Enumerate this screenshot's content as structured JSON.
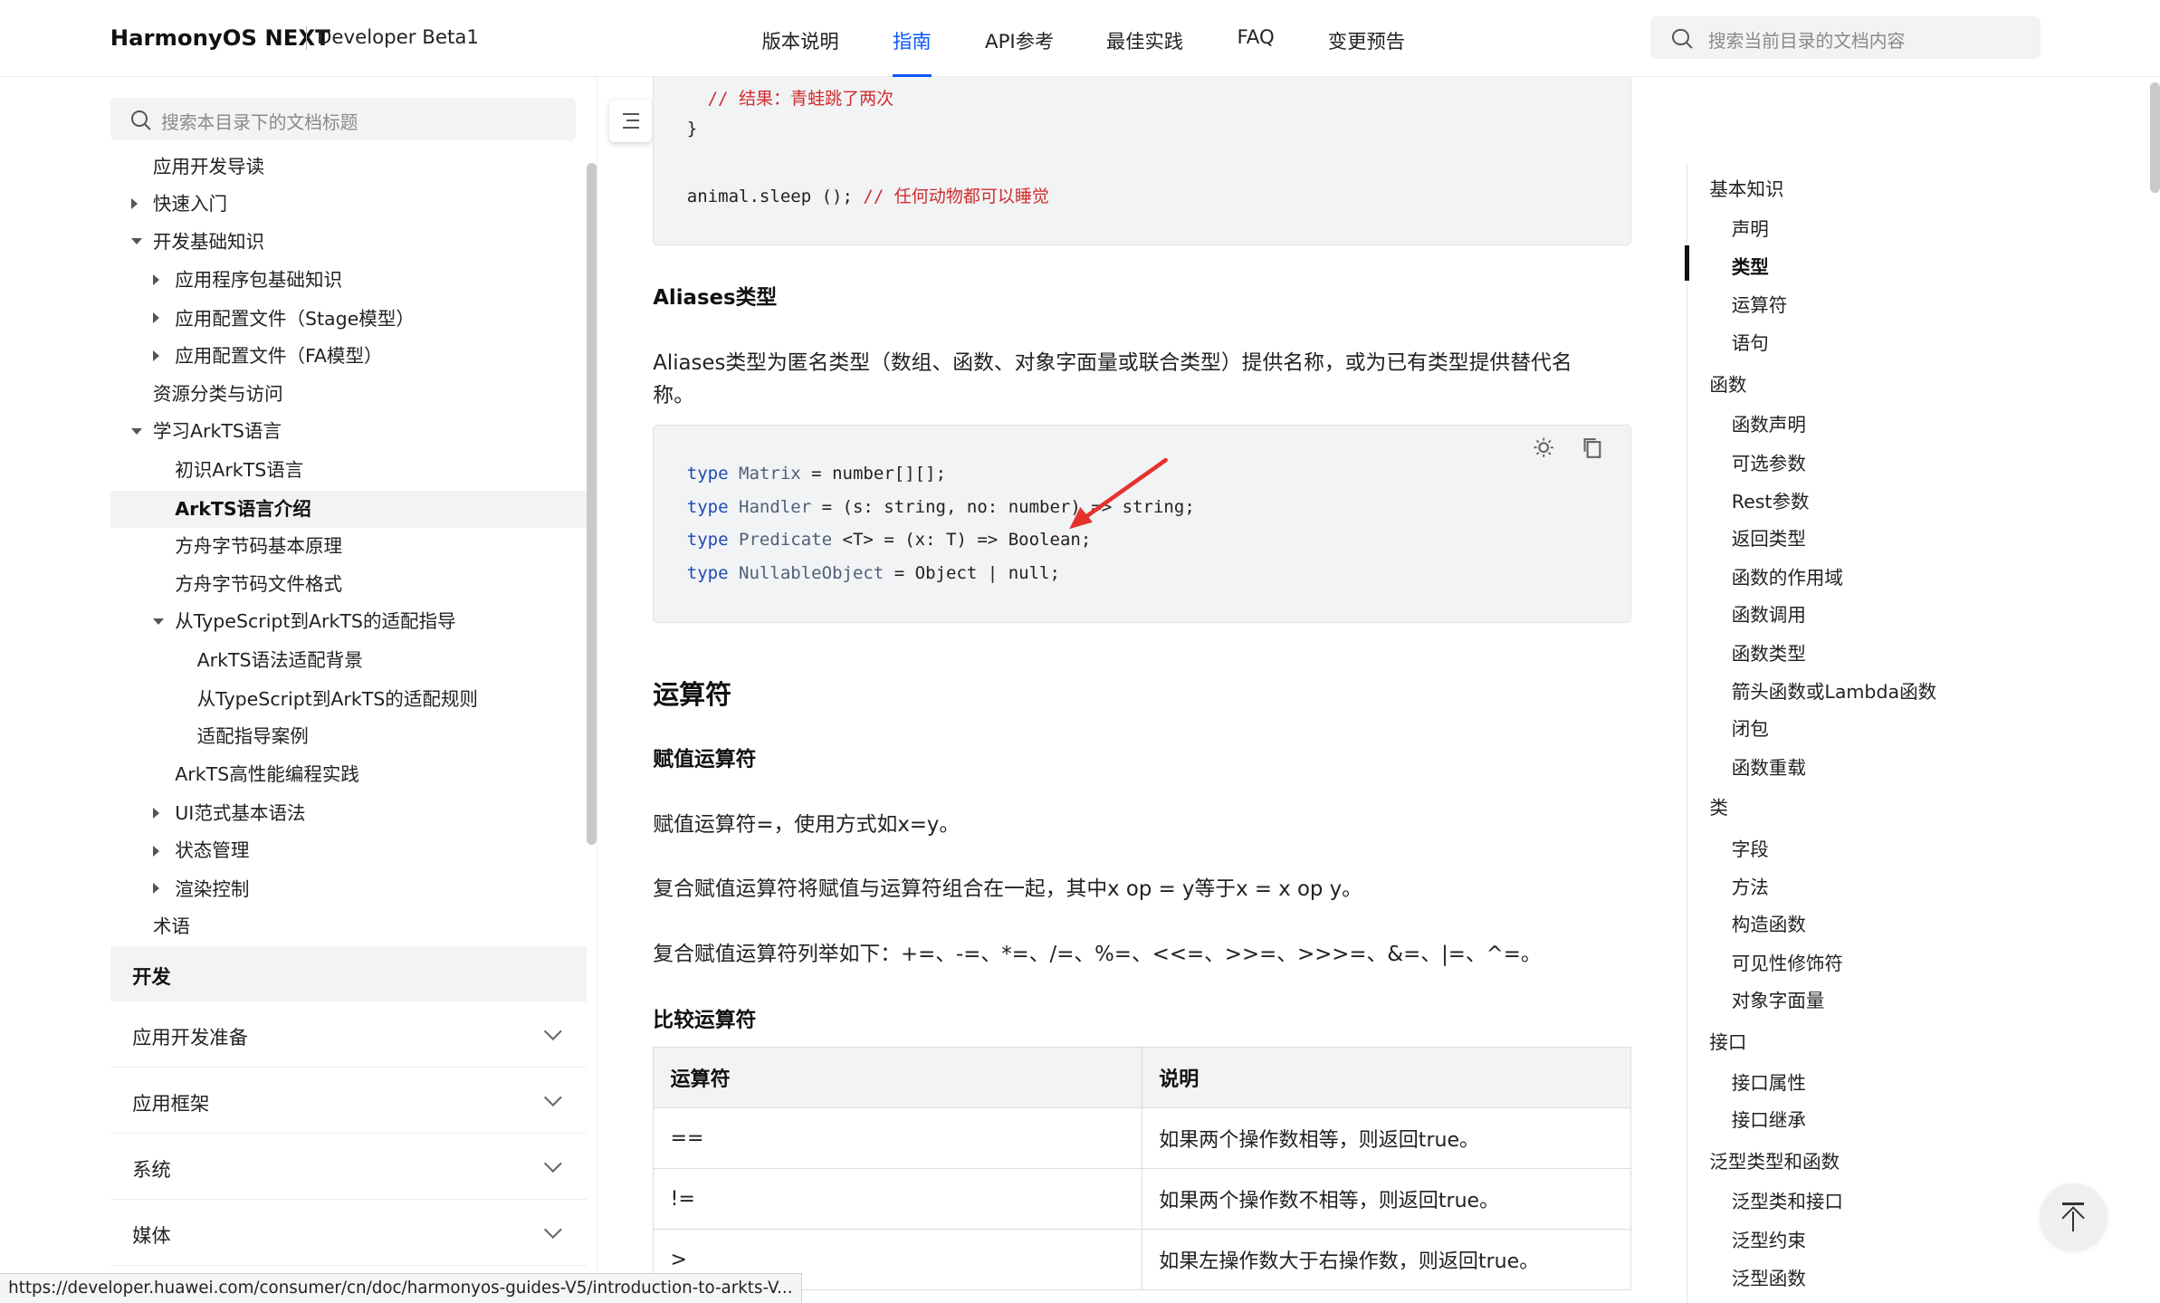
{
  "header": {
    "brand": "HarmonyOS NEXT",
    "brand_sub": "Developer Beta1",
    "nav": [
      "版本说明",
      "指南",
      "API参考",
      "最佳实践",
      "FAQ",
      "变更预告"
    ],
    "active_nav": "指南",
    "search_placeholder": "搜索当前目录的文档内容"
  },
  "sidebar": {
    "search_placeholder": "搜索本目录下的文档标题",
    "tree": [
      {
        "label": "应用开发导读",
        "level": 0,
        "state": "leaf"
      },
      {
        "label": "快速入门",
        "level": 0,
        "state": "collapsed"
      },
      {
        "label": "开发基础知识",
        "level": 0,
        "state": "expanded"
      },
      {
        "label": "应用程序包基础知识",
        "level": 1,
        "state": "collapsed"
      },
      {
        "label": "应用配置文件（Stage模型）",
        "level": 1,
        "state": "collapsed"
      },
      {
        "label": "应用配置文件（FA模型）",
        "level": 1,
        "state": "collapsed"
      },
      {
        "label": "资源分类与访问",
        "level": 0,
        "state": "leaf"
      },
      {
        "label": "学习ArkTS语言",
        "level": 0,
        "state": "expanded"
      },
      {
        "label": "初识ArkTS语言",
        "level": 1,
        "state": "leaf"
      },
      {
        "label": "ArkTS语言介绍",
        "level": 1,
        "state": "selected"
      },
      {
        "label": "方舟字节码基本原理",
        "level": 1,
        "state": "leaf"
      },
      {
        "label": "方舟字节码文件格式",
        "level": 1,
        "state": "leaf"
      },
      {
        "label": "从TypeScript到ArkTS的适配指导",
        "level": 1,
        "state": "expanded"
      },
      {
        "label": "ArkTS语法适配背景",
        "level": 2,
        "state": "leaf"
      },
      {
        "label": "从TypeScript到ArkTS的适配规则",
        "level": 2,
        "state": "leaf"
      },
      {
        "label": "适配指导案例",
        "level": 2,
        "state": "leaf"
      },
      {
        "label": "ArkTS高性能编程实践",
        "level": 1,
        "state": "leaf"
      },
      {
        "label": "UI范式基本语法",
        "level": 1,
        "state": "collapsed"
      },
      {
        "label": "状态管理",
        "level": 1,
        "state": "collapsed"
      },
      {
        "label": "渲染控制",
        "level": 1,
        "state": "collapsed"
      },
      {
        "label": "术语",
        "level": 0,
        "state": "leaf"
      }
    ],
    "section": "开发",
    "categories": [
      "应用开发准备",
      "应用框架",
      "系统",
      "媒体"
    ]
  },
  "main": {
    "code1": {
      "comment_line": "// 结果：青蛙跳了两次",
      "brace": "}",
      "call": "animal.sleep ();",
      "call_comment": "// 任何动物都可以睡觉"
    },
    "aliases_heading": "Aliases类型",
    "aliases_text_line1": "Aliases类型为匿名类型（数组、函数、对象字面量或联合类型）提供名称，或为已有类型提供替代名",
    "aliases_text_line2": "称。",
    "code2": [
      {
        "kw": "type",
        "name": "Matrix",
        "rest": " = number[][];"
      },
      {
        "kw": "type",
        "name": "Handler",
        "rest": " = (s: string, no: number) => string;"
      },
      {
        "kw": "type",
        "name": "Predicate",
        "rest": " <T> = (x: T) => Boolean;"
      },
      {
        "kw": "type",
        "name": "NullableObject",
        "rest": " = Object | null;"
      }
    ],
    "operators_heading": "运算符",
    "assign_heading": "赋值运算符",
    "assign_p1": "赋值运算符=，使用方式如x=y。",
    "assign_p2": "复合赋值运算符将赋值与运算符组合在一起，其中x op = y等于x = x op y。",
    "assign_p3": "复合赋值运算符列举如下：+=、-=、*=、/=、%=、<<=、>>=、>>>=、&=、|=、^=。",
    "compare_heading": "比较运算符",
    "table": {
      "headers": [
        "运算符",
        "说明"
      ],
      "rows": [
        [
          "==",
          "如果两个操作数相等，则返回true。"
        ],
        [
          "!=",
          "如果两个操作数不相等，则返回true。"
        ],
        [
          ">",
          "如果左操作数大于右操作数，则返回true。"
        ]
      ]
    }
  },
  "toc": [
    {
      "label": "基本知识",
      "level": 0
    },
    {
      "label": "声明",
      "level": 1
    },
    {
      "label": "类型",
      "level": 1,
      "active": true
    },
    {
      "label": "运算符",
      "level": 1
    },
    {
      "label": "语句",
      "level": 1
    },
    {
      "label": "函数",
      "level": 0
    },
    {
      "label": "函数声明",
      "level": 1
    },
    {
      "label": "可选参数",
      "level": 1
    },
    {
      "label": "Rest参数",
      "level": 1
    },
    {
      "label": "返回类型",
      "level": 1
    },
    {
      "label": "函数的作用域",
      "level": 1
    },
    {
      "label": "函数调用",
      "level": 1
    },
    {
      "label": "函数类型",
      "level": 1
    },
    {
      "label": "箭头函数或Lambda函数",
      "level": 1
    },
    {
      "label": "闭包",
      "level": 1
    },
    {
      "label": "函数重载",
      "level": 1
    },
    {
      "label": "类",
      "level": 0
    },
    {
      "label": "字段",
      "level": 1
    },
    {
      "label": "方法",
      "level": 1
    },
    {
      "label": "构造函数",
      "level": 1
    },
    {
      "label": "可见性修饰符",
      "level": 1
    },
    {
      "label": "对象字面量",
      "level": 1
    },
    {
      "label": "接口",
      "level": 0
    },
    {
      "label": "接口属性",
      "level": 1
    },
    {
      "label": "接口继承",
      "level": 1
    },
    {
      "label": "泛型类型和函数",
      "level": 0
    },
    {
      "label": "泛型类和接口",
      "level": 1
    },
    {
      "label": "泛型约束",
      "level": 1
    },
    {
      "label": "泛型函数",
      "level": 1
    }
  ],
  "status_url": "https://developer.huawei.com/consumer/cn/doc/harmonyos-guides-V5/introduction-to-arkts-V...",
  "colors": {
    "accent": "#0a59f7",
    "annotation_arrow": "#e5322d",
    "code_comment": "#d12d2d",
    "code_keyword": "#1f4bb3"
  },
  "icons": [
    "search-icon",
    "collapse-sidebar-icon",
    "theme-toggle-icon",
    "copy-icon",
    "chevron-down-icon",
    "back-to-top-icon"
  ]
}
